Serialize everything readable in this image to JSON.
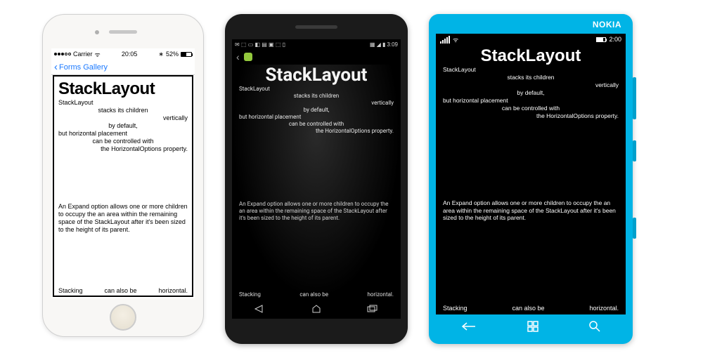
{
  "content": {
    "title": "StackLayout",
    "lines": [
      {
        "text": "StackLayout",
        "align": "start"
      },
      {
        "text": "stacks its children",
        "align": "center"
      },
      {
        "text": "vertically",
        "align": "end"
      },
      {
        "text": "by default,",
        "align": "center"
      },
      {
        "text": "but horizontal placement",
        "align": "start"
      },
      {
        "text": "can be controlled with",
        "align": "center"
      },
      {
        "text": "the HorizontalOptions property.",
        "align": "end"
      }
    ],
    "paragraph_ios": "An Expand option allows one or more children to occupy the an area within the remaining space of the StackLayout after it's been sized to the height of its parent.",
    "paragraph_android": "An Expand option allows one or more children to occupy the an area within the remaining space of the StackLayout after it's been sized to the height of its parent.",
    "paragraph_wp": "An Expand option allows one or more children to occupy the an area within the remaining space of the StackLayout after it's been sized to the height of its parent.",
    "hstack": {
      "a": "Stacking",
      "b": "can also be",
      "c": "horizontal."
    }
  },
  "ios": {
    "carrier": "Carrier",
    "wifi_glyph": "ᯤ",
    "time": "20:05",
    "battery_pct": "52%",
    "bt_glyph": "∗",
    "back_label": "Forms Gallery"
  },
  "android": {
    "time": "3:09",
    "notif_glyphs": "✉ ⬚ ▭ ◧ ▤ ▣ ⬚ ▯",
    "right_glyphs": "▦ ◢ ▮",
    "soft": {
      "back_glyph": "◁",
      "home_glyph": "◯",
      "recent_glyph": "▭"
    }
  },
  "wp": {
    "brand": "NOKIA",
    "battery_glyph": "",
    "time": "2:00",
    "wifi_glyph": "ᯤ",
    "soft": {
      "back": "←",
      "home": "⊞",
      "search": "⌕"
    }
  }
}
